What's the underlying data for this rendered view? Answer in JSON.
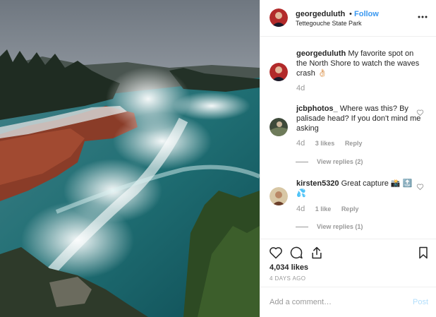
{
  "header": {
    "username": "georgeduluth",
    "dot": "•",
    "follow_label": "Follow",
    "location": "Tettegouche State Park"
  },
  "comments": [
    {
      "username": "georgeduluth",
      "text": "My favorite spot on the North Shore to watch the waves crash 👌🏻",
      "age": "4d"
    },
    {
      "username": "jcbphotos_",
      "text": "Where was this? By palisade head? If you don't mind me asking",
      "age": "4d",
      "likes": "3 likes",
      "reply": "Reply",
      "view_replies": "View replies (2)"
    },
    {
      "username": "kirsten5320",
      "text": "Great capture 📸 🔝 💦",
      "age": "4d",
      "likes": "1 like",
      "reply": "Reply",
      "view_replies": "View replies (1)"
    }
  ],
  "actions": {
    "likes": "4,034 likes",
    "time": "4 DAYS AGO"
  },
  "add_comment": {
    "placeholder": "Add a comment…",
    "post_label": "Post"
  },
  "colors": {
    "accent": "#3897f0",
    "post_disabled": "#b2dffc",
    "text": "#262626",
    "muted": "#999999"
  },
  "icons": [
    "more-icon",
    "heart-icon",
    "comment-icon",
    "share-icon",
    "bookmark-icon",
    "heart-small-icon"
  ]
}
